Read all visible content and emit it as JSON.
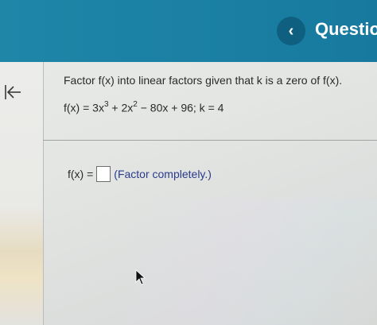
{
  "header": {
    "back_glyph": "‹",
    "title": "Question"
  },
  "sidebar": {
    "collapse_icon": "collapse-left-icon"
  },
  "question": {
    "prompt": "Factor f(x) into linear factors given that k is a zero of f(x).",
    "equation": {
      "lhs": "f(x) = 3x",
      "exp1": "3",
      "term2": " + 2x",
      "exp2": "2",
      "rest": " − 80x + 96; k = 4"
    }
  },
  "answer": {
    "label": "f(x) =",
    "value": "",
    "hint": "(Factor completely.)"
  },
  "colors": {
    "header_bg": "#1a7fa3",
    "back_button_bg": "#0e5f80",
    "hint_text": "#2a3a8c"
  }
}
